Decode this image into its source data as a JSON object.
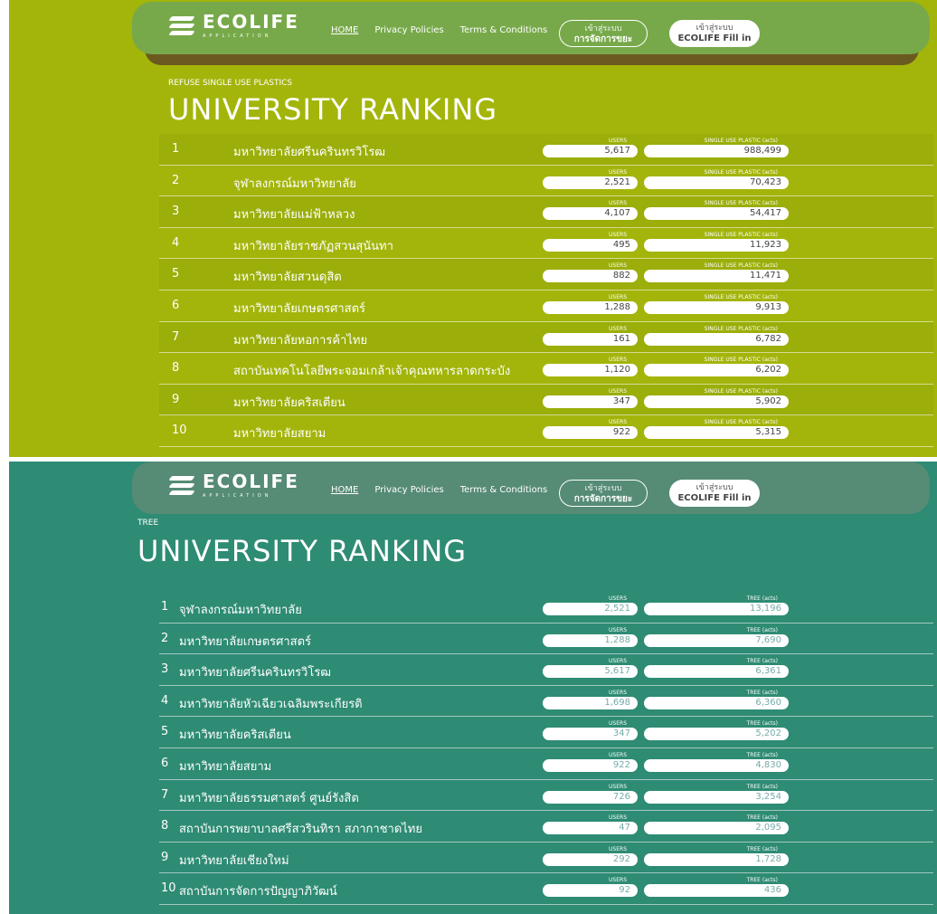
{
  "header_strip": {
    "text": ""
  },
  "nav": {
    "brand": "ECOLIFE",
    "brand_sub": "APPLICATION",
    "links": [
      "HOME",
      "Privacy Policies",
      "Terms & Conditions"
    ],
    "btn_waste_small": "เข้าสู่ระบบ",
    "btn_waste_big": "การจัดการขยะ",
    "btn_fill_small": "เข้าสู่ระบบ",
    "btn_fill_big": "ECOLIFE Fill in"
  },
  "plastics": {
    "kicker": "REFUSE SINGLE USE PLASTICS",
    "title": "UNIVERSITY RANKING",
    "users_label": "USERS",
    "value_label": "SINGLE USE PLASTIC (acts)",
    "rows": [
      {
        "rank": "1",
        "name": "มหาวิทยาลัยศรีนครินทรวิโรฒ",
        "users": "5,617",
        "value": "988,499"
      },
      {
        "rank": "2",
        "name": "จุฬาลงกรณ์มหาวิทยาลัย",
        "users": "2,521",
        "value": "70,423"
      },
      {
        "rank": "3",
        "name": "มหาวิทยาลัยแม่ฟ้าหลวง",
        "users": "4,107",
        "value": "54,417"
      },
      {
        "rank": "4",
        "name": "มหาวิทยาลัยราชภัฏสวนสุนันทา",
        "users": "495",
        "value": "11,923"
      },
      {
        "rank": "5",
        "name": "มหาวิทยาลัยสวนดุสิต",
        "users": "882",
        "value": "11,471"
      },
      {
        "rank": "6",
        "name": "มหาวิทยาลัยเกษตรศาสตร์",
        "users": "1,288",
        "value": "9,913"
      },
      {
        "rank": "7",
        "name": "มหาวิทยาลัยหอการค้าไทย",
        "users": "161",
        "value": "6,782"
      },
      {
        "rank": "8",
        "name": "สถาบันเทคโนโลยีพระจอมเกล้าเจ้าคุณทหารลาดกระบัง",
        "users": "1,120",
        "value": "6,202"
      },
      {
        "rank": "9",
        "name": "มหาวิทยาลัยคริสเตียน",
        "users": "347",
        "value": "5,902"
      },
      {
        "rank": "10",
        "name": "มหาวิทยาลัยสยาม",
        "users": "922",
        "value": "5,315"
      }
    ]
  },
  "tree": {
    "kicker": "TREE",
    "title": "UNIVERSITY RANKING",
    "users_label": "USERS",
    "value_label": "TREE (acts)",
    "rows": [
      {
        "rank": "1",
        "name": "จุฬาลงกรณ์มหาวิทยาลัย",
        "users": "2,521",
        "value": "13,196"
      },
      {
        "rank": "2",
        "name": "มหาวิทยาลัยเกษตรศาสตร์",
        "users": "1,288",
        "value": "7,690"
      },
      {
        "rank": "3",
        "name": "มหาวิทยาลัยศรีนครินทรวิโรฒ",
        "users": "5,617",
        "value": "6,361"
      },
      {
        "rank": "4",
        "name": "มหาวิทยาลัยหัวเฉียวเฉลิมพระเกียรติ",
        "users": "1,698",
        "value": "6,360"
      },
      {
        "rank": "5",
        "name": "มหาวิทยาลัยคริสเตียน",
        "users": "347",
        "value": "5,202"
      },
      {
        "rank": "6",
        "name": "มหาวิทยาลัยสยาม",
        "users": "922",
        "value": "4,830"
      },
      {
        "rank": "7",
        "name": "มหาวิทยาลัยธรรมศาสตร์ ศูนย์รังสิต",
        "users": "726",
        "value": "3,254"
      },
      {
        "rank": "8",
        "name": "สถาบันการพยาบาลศรีสวรินทิรา สภากาชาดไทย",
        "users": "47",
        "value": "2,095"
      },
      {
        "rank": "9",
        "name": "มหาวิทยาลัยเชียงใหม่",
        "users": "292",
        "value": "1,728"
      },
      {
        "rank": "10",
        "name": "สถาบันการจัดการปัญญาภิวัฒน์",
        "users": "92",
        "value": "436"
      }
    ]
  }
}
